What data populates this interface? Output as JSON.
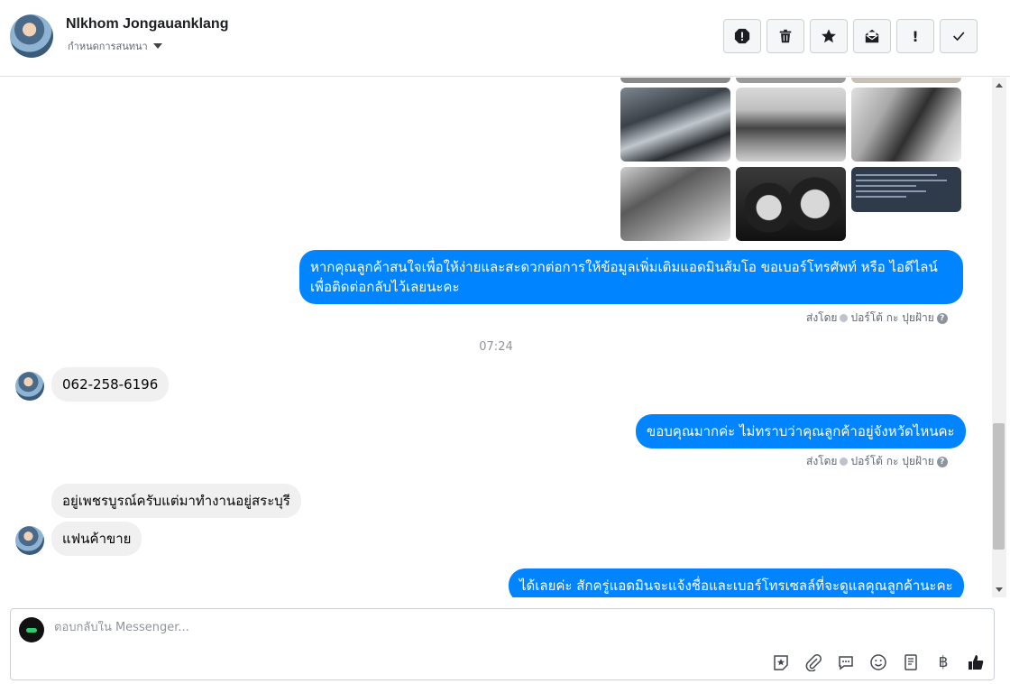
{
  "header": {
    "contact_name": "Nlkhom Jongauanklang",
    "subtitle": "กำหนดการสนทนา",
    "actions": [
      {
        "name": "report-icon",
        "label": "!"
      },
      {
        "name": "trash-icon",
        "label": ""
      },
      {
        "name": "star-icon",
        "label": ""
      },
      {
        "name": "mark-unread-icon",
        "label": ""
      },
      {
        "name": "follow-up-icon",
        "label": "!"
      },
      {
        "name": "done-icon",
        "label": ""
      }
    ]
  },
  "thread": {
    "photos": [
      "engine",
      "dashboard",
      "seat",
      "gear",
      "gauge",
      "document"
    ],
    "messages": [
      {
        "side": "out",
        "lines": [
          "หากคุณลูกค้าสนใจเพื่อให้ง่ายและสะดวกต่อการให้ข้อมูลเพิ่มเติมแอดมินส้มโอ ขอเบอร์โทรศัพท์ หรือ ไอดีไลน์",
          "เพื่อติดต่อกลับไว้เลยนะคะ"
        ]
      },
      {
        "side": "in",
        "lines": [
          "062-258-6196"
        ]
      },
      {
        "side": "out",
        "lines": [
          "ขอบคุณมากค่ะ ไม่ทราบว่าคุณลูกค้าอยู่จังหวัดไหนคะ"
        ]
      },
      {
        "side": "in",
        "lines": [
          "อยู่เพชรบูรณ์ครับแต่มาทำงานอยู่สระบุรี"
        ]
      },
      {
        "side": "in",
        "lines": [
          "แฟนค้าขาย"
        ]
      },
      {
        "side": "out",
        "lines": [
          "ได้เลยค่ะ สักครู่แอดมินจะแจ้งชื่อและเบอร์โทรเซลล์ที่จะดูแลคุณลูกค้านะคะ"
        ]
      }
    ],
    "sent_by_prefix": "ส่งโดย",
    "sent_by_name": "ปอร์โต้ กะ ปุยฝ้าย",
    "timestamp": "07:24"
  },
  "composer": {
    "placeholder": "ตอบกลับใน Messenger...",
    "tools": [
      "sticker-star-icon",
      "attachment-icon",
      "saved-reply-icon",
      "emoji-icon",
      "order-form-icon",
      "baht-icon",
      "like-icon"
    ]
  },
  "colors": {
    "outgoing_bubble": "#0084ff",
    "incoming_bubble": "#f0f0f0"
  }
}
